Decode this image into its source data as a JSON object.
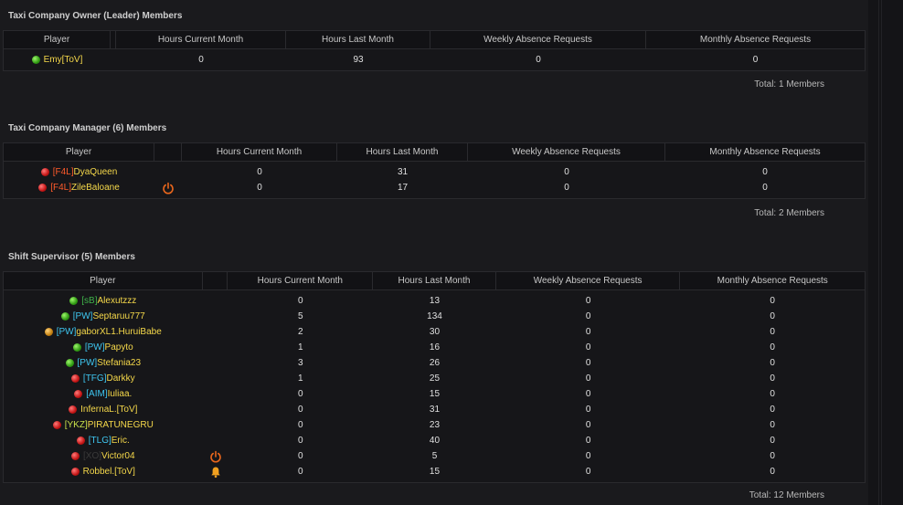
{
  "sections": [
    {
      "title": "Taxi Company Owner (Leader) Members",
      "headers": [
        "Player",
        "",
        "Hours Current Month",
        "Hours Last Month",
        "Weekly Absence Requests",
        "Monthly Absence Requests"
      ],
      "rows": [
        {
          "status": "green",
          "tag": "",
          "tag_color": "",
          "name": "Emy[ToV]",
          "icon": "",
          "hcm": "0",
          "hlm": "93",
          "war": "0",
          "mar": "0"
        }
      ],
      "total": "Total: 1 Members"
    },
    {
      "title": "Taxi Company Manager (6) Members",
      "headers": [
        "Player",
        "",
        "Hours Current Month",
        "Hours Last Month",
        "Weekly Absence Requests",
        "Monthly Absence Requests"
      ],
      "rows": [
        {
          "status": "red",
          "tag": "[F4L]",
          "tag_color": "#ff5a2a",
          "name": "DyaQueen",
          "icon": "",
          "hcm": "0",
          "hlm": "31",
          "war": "0",
          "mar": "0"
        },
        {
          "status": "red",
          "tag": "[F4L]",
          "tag_color": "#ff5a2a",
          "name": "ZileBaloane",
          "icon": "power-icon",
          "hcm": "0",
          "hlm": "17",
          "war": "0",
          "mar": "0"
        }
      ],
      "total": "Total: 2 Members"
    },
    {
      "title": "Shift Supervisor (5) Members",
      "headers": [
        "Player",
        "",
        "Hours Current Month",
        "Hours Last Month",
        "Weekly Absence Requests",
        "Monthly Absence Requests"
      ],
      "rows": [
        {
          "status": "green",
          "tag": "[sB]",
          "tag_color": "#3fb34a",
          "name": "Alexutzzz",
          "icon": "",
          "hcm": "0",
          "hlm": "13",
          "war": "0",
          "mar": "0"
        },
        {
          "status": "green",
          "tag": "[PW]",
          "tag_color": "#3ec6f0",
          "name": "Septaruu777",
          "icon": "",
          "hcm": "5",
          "hlm": "134",
          "war": "0",
          "mar": "0"
        },
        {
          "status": "orange",
          "tag": "[PW]",
          "tag_color": "#3ec6f0",
          "name": "gaborXL1.HuruiBabe",
          "icon": "",
          "hcm": "2",
          "hlm": "30",
          "war": "0",
          "mar": "0"
        },
        {
          "status": "green",
          "tag": "[PW]",
          "tag_color": "#3ec6f0",
          "name": "Papyto",
          "icon": "",
          "hcm": "1",
          "hlm": "16",
          "war": "0",
          "mar": "0"
        },
        {
          "status": "green",
          "tag": "[PW]",
          "tag_color": "#3ec6f0",
          "name": "Stefania23",
          "icon": "",
          "hcm": "3",
          "hlm": "26",
          "war": "0",
          "mar": "0"
        },
        {
          "status": "red",
          "tag": "[TFG]",
          "tag_color": "#3ec6f0",
          "name": "Darkky",
          "icon": "",
          "hcm": "1",
          "hlm": "25",
          "war": "0",
          "mar": "0"
        },
        {
          "status": "red",
          "tag": "[AIM]",
          "tag_color": "#3ec6f0",
          "name": "Iuliaa.",
          "icon": "",
          "hcm": "0",
          "hlm": "15",
          "war": "0",
          "mar": "0"
        },
        {
          "status": "red",
          "tag": "",
          "tag_color": "",
          "name": "InfernaL.[ToV]",
          "icon": "",
          "hcm": "0",
          "hlm": "31",
          "war": "0",
          "mar": "0"
        },
        {
          "status": "red",
          "tag": "[YKZ]",
          "tag_color": "#c8e04a",
          "name": "PIRATUNEGRU",
          "icon": "",
          "hcm": "0",
          "hlm": "23",
          "war": "0",
          "mar": "0"
        },
        {
          "status": "red",
          "tag": "[TLG]",
          "tag_color": "#3ec6f0",
          "name": "Eric.",
          "icon": "",
          "hcm": "0",
          "hlm": "40",
          "war": "0",
          "mar": "0"
        },
        {
          "status": "red",
          "tag": "[XO]",
          "tag_color": "#3a3a3a",
          "name": "Victor04",
          "icon": "power-icon",
          "hcm": "0",
          "hlm": "5",
          "war": "0",
          "mar": "0"
        },
        {
          "status": "red",
          "tag": "",
          "tag_color": "",
          "name": "Robbel.[ToV]",
          "icon": "bell-icon",
          "hcm": "0",
          "hlm": "15",
          "war": "0",
          "mar": "0"
        }
      ],
      "total": "Total: 12 Members"
    }
  ],
  "colors": {
    "background": "#1a1a1d",
    "name_yellow": "#f5d84a",
    "icon_orange": "#e8661c"
  }
}
